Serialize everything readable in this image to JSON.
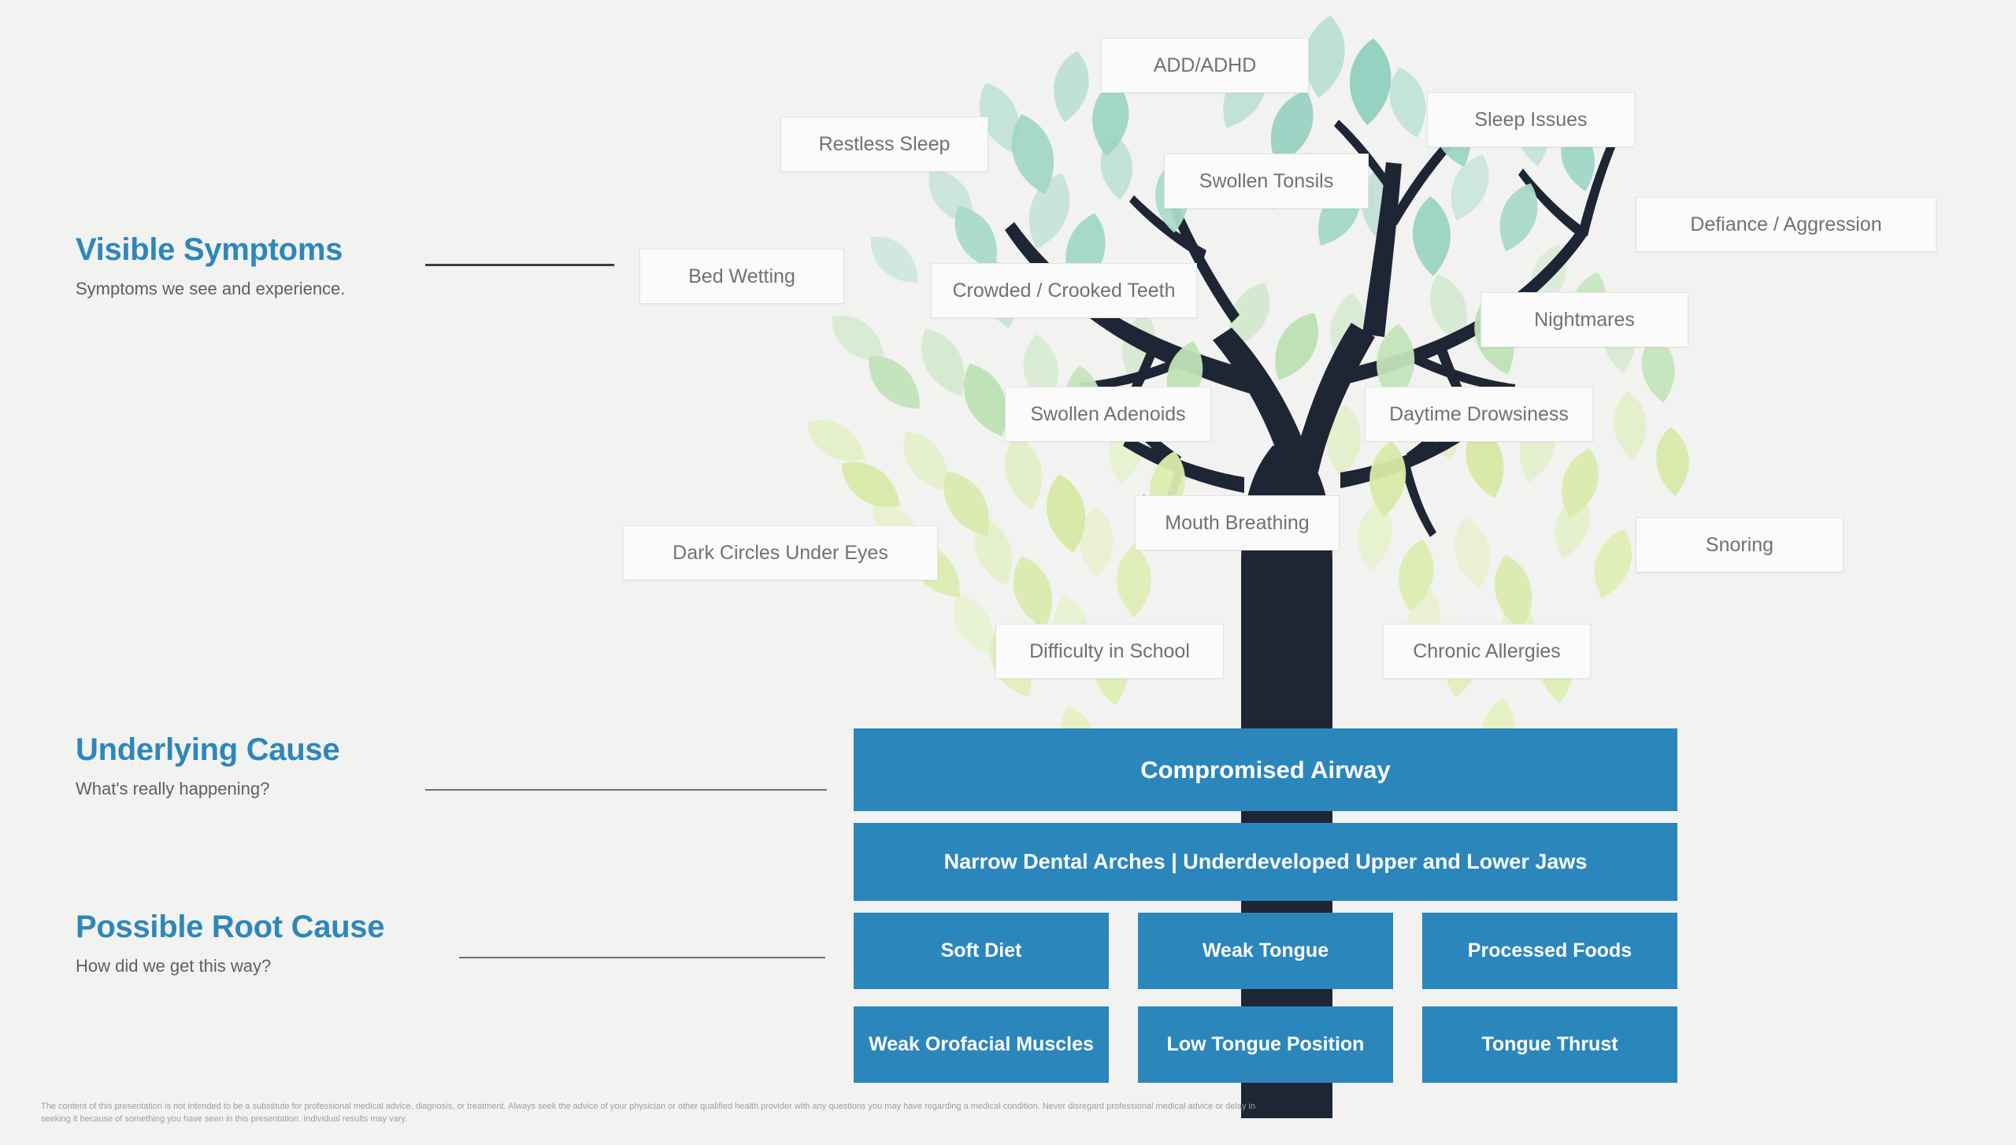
{
  "theme": {
    "background": "#f2f2f1",
    "accent_blue": "#2b86bc",
    "heading_blue": "#2d87ba",
    "trunk_navy": "#1e2635",
    "chip_text": "#6e7275",
    "leaf_teal": "#a8d9cd",
    "leaf_mint": "#bfe0cf",
    "leaf_green": "#cde6c0",
    "leaf_lime": "#dcecb0",
    "leaf_pale": "#e4f0b8"
  },
  "sections": [
    {
      "id": "visible-symptoms",
      "title": "Visible Symptoms",
      "subtitle": "Symptoms we see and experience."
    },
    {
      "id": "underlying-cause",
      "title": "Underlying Cause",
      "subtitle": "What's really happening?"
    },
    {
      "id": "possible-root-cause",
      "title": "Possible Root Cause",
      "subtitle": "How did we get this way?"
    }
  ],
  "symptoms": [
    {
      "id": "add-adhd",
      "label": "ADD/ADHD"
    },
    {
      "id": "restless-sleep",
      "label": "Restless Sleep"
    },
    {
      "id": "sleep-issues",
      "label": "Sleep Issues"
    },
    {
      "id": "swollen-tonsils",
      "label": "Swollen Tonsils"
    },
    {
      "id": "defiance-aggression",
      "label": "Defiance / Aggression"
    },
    {
      "id": "bed-wetting",
      "label": "Bed Wetting"
    },
    {
      "id": "crowded-crooked-teeth",
      "label": "Crowded / Crooked Teeth"
    },
    {
      "id": "nightmares",
      "label": "Nightmares"
    },
    {
      "id": "swollen-adenoids",
      "label": "Swollen Adenoids"
    },
    {
      "id": "daytime-drowsiness",
      "label": "Daytime Drowsiness"
    },
    {
      "id": "mouth-breathing",
      "label": "Mouth Breathing"
    },
    {
      "id": "dark-circles",
      "label": "Dark Circles Under Eyes"
    },
    {
      "id": "snoring",
      "label": "Snoring"
    },
    {
      "id": "difficulty-in-school",
      "label": "Difficulty in School"
    },
    {
      "id": "chronic-allergies",
      "label": "Chronic Allergies"
    }
  ],
  "underlying": {
    "primary": "Compromised Airway",
    "secondary": "Narrow Dental Arches | Underdeveloped Upper and Lower Jaws"
  },
  "root_causes": [
    {
      "id": "soft-diet",
      "label": "Soft Diet"
    },
    {
      "id": "weak-tongue",
      "label": "Weak Tongue"
    },
    {
      "id": "processed-foods",
      "label": "Processed Foods"
    },
    {
      "id": "weak-orofacial-muscles",
      "label": "Weak Orofacial Muscles"
    },
    {
      "id": "low-tongue-position",
      "label": "Low Tongue Position"
    },
    {
      "id": "tongue-thrust",
      "label": "Tongue Thrust"
    }
  ],
  "disclaimer": "The content of this presentation is not intended to be a substitute for professional medical advice, diagnosis, or treatment. Always seek the advice of your physician or other qualified health provider with any questions you may have regarding a medical condition. Never disregard professional medical advice or delay in seeking it because of something you have seen in this presentation. Individual results may vary."
}
